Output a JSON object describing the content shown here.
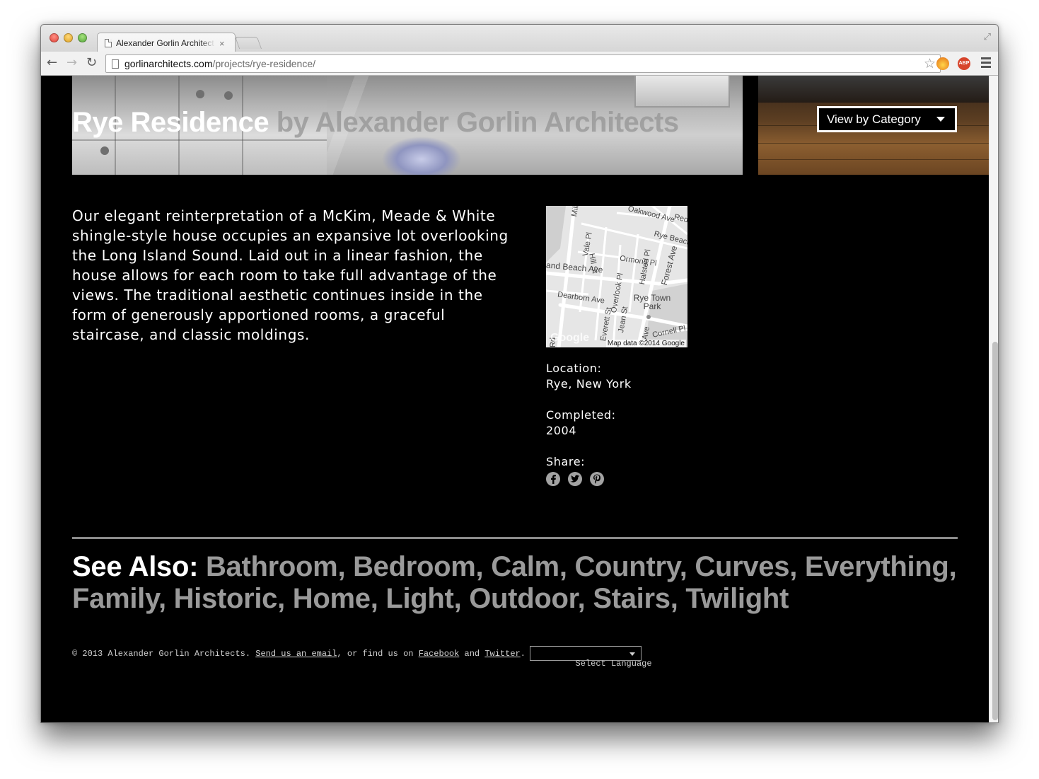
{
  "browser": {
    "tab_title": "Alexander Gorlin Architect",
    "tab_close": "×",
    "url_host": "gorlinarchitects.com",
    "url_path": "/projects/rye-residence/",
    "icons": [
      "back-icon",
      "forward-icon",
      "reload-icon",
      "page-icon",
      "star-icon",
      "menu-icon"
    ],
    "extensions": {
      "abp_label": "ABP"
    }
  },
  "hero": {
    "title_name": "Rye Residence",
    "title_by": " by Alexander Gorlin Architects",
    "category_label": "View by Category"
  },
  "project": {
    "description": "Our elegant reinterpretation of a McKim, Meade & White shingle-style house occupies an expansive lot overlooking the Long Island Sound. Laid out in a linear fashion, the house allows for each room to take full advantage of the views. The traditional aesthetic continues inside in the form of generously apportioned rooms, a graceful staircase, and classic moldings.",
    "location_label": "Location:",
    "location_value": "Rye, New York",
    "completed_label": "Completed:",
    "completed_value": "2004",
    "share_label": "Share:",
    "share_icons": [
      "facebook-icon",
      "twitter-icon",
      "pinterest-icon"
    ]
  },
  "map": {
    "labels": {
      "milton": "Milton",
      "oakwood": "Oakwood Ave",
      "red": "Red",
      "rye_beach": "Rye Beach",
      "vale": "Vale Pl",
      "hill": "Hill St",
      "ormond": "Ormond Pl",
      "beach_ave": "and Beach Ave",
      "halsted": "Halsted Pl",
      "forest": "Forest Ave",
      "dearborn": "Dearborn Ave",
      "overlook": "Overlook Pl",
      "rye_town_park": "Rye Town Park",
      "everett": "Everett St",
      "jean": "Jean St",
      "cornell": "Cornell Pl",
      "ave": "Ave",
      "rd": "Rd"
    },
    "google": "Google",
    "credit": "Map data ©2014 Google"
  },
  "see_also": {
    "lead": "See Also:",
    "tags": [
      "Bathroom",
      "Bedroom",
      "Calm",
      "Country",
      "Curves",
      "Everything",
      "Family",
      "Historic",
      "Home",
      "Light",
      "Outdoor",
      "Stairs",
      "Twilight"
    ]
  },
  "footer": {
    "copyright": "© 2013 Alexander Gorlin Architects. ",
    "email_link": "Send us an email",
    "mid_text": ", or find us on ",
    "facebook_link": "Facebook",
    "and_text": " and ",
    "twitter_link": "Twitter",
    "end_text": ".",
    "language_select": "Select Language"
  },
  "colors": {
    "page_background": "#000000",
    "text_primary": "#ffffff",
    "tag_gray": "#9a9a9a",
    "divider": "#8c8c8c"
  }
}
